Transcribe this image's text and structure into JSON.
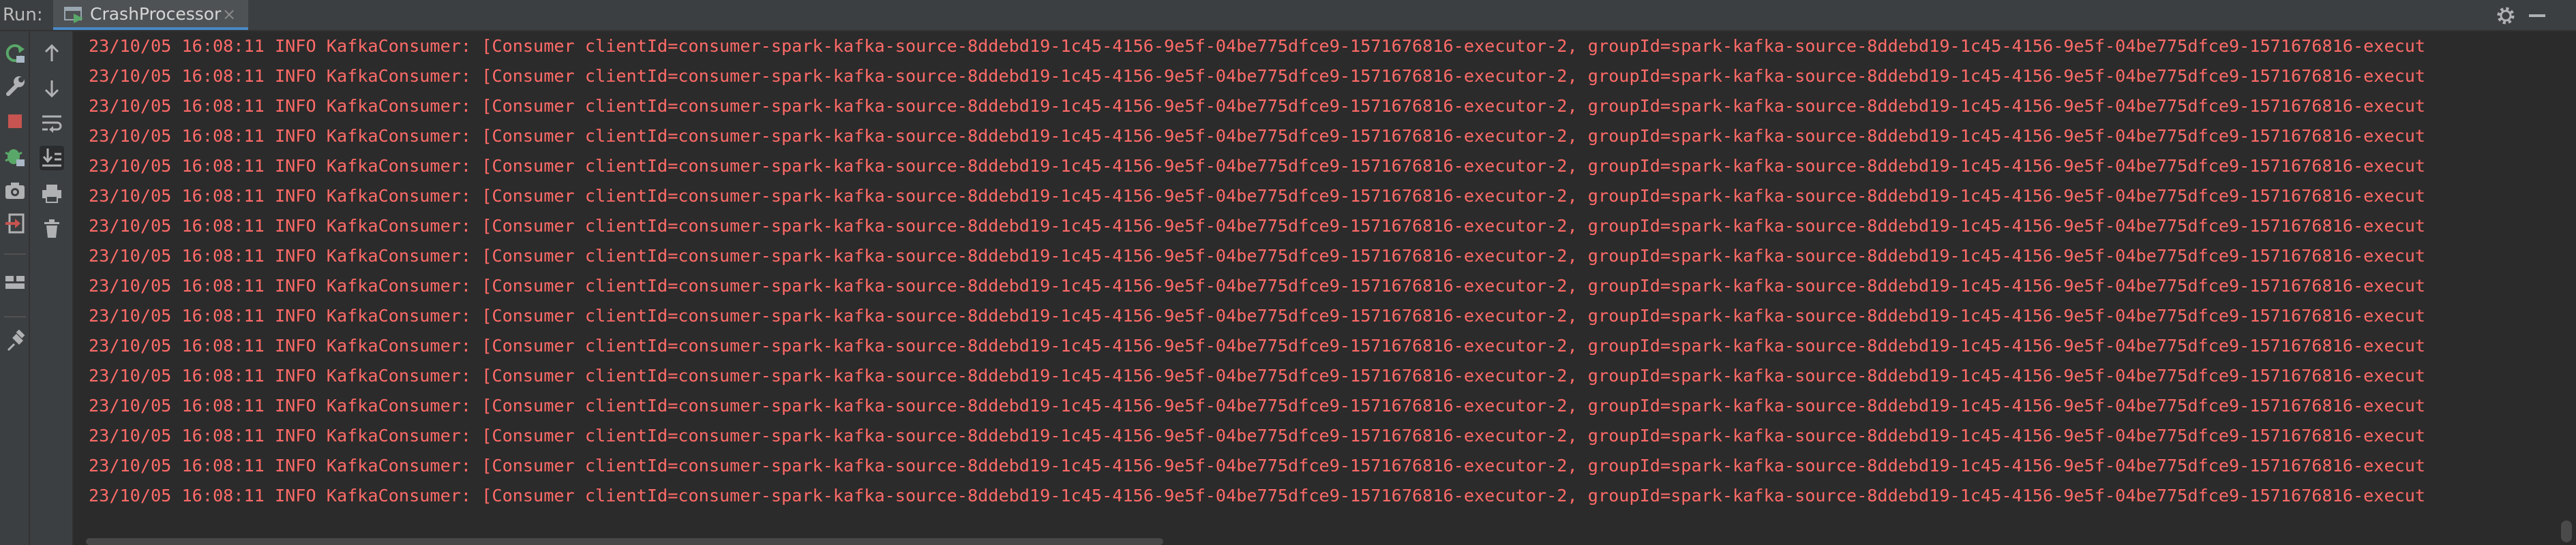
{
  "header": {
    "run_label": "Run:",
    "tab_label": "CrashProcessor",
    "tab_close": "×"
  },
  "icons": {
    "left_toolbar": [
      "rerun-icon",
      "wrench-icon",
      "stop-icon",
      "debug-icon",
      "camera-icon",
      "exit-icon",
      "layout-icon",
      "pin-icon"
    ],
    "right_toolbar": [
      "arrow-up-icon",
      "arrow-down-icon",
      "soft-wrap-icon",
      "scroll-to-end-icon",
      "print-icon",
      "trash-icon"
    ],
    "header_right": [
      "gear-icon",
      "minimize-icon"
    ]
  },
  "colors": {
    "log_text": "#ff6b68",
    "panel_bg": "#3c3f41",
    "console_bg": "#2b2b2b",
    "tab_accent": "#4a88c7"
  },
  "console": {
    "lines": [
      "23/10/05 16:08:11 INFO KafkaConsumer: [Consumer clientId=consumer-spark-kafka-source-8ddebd19-1c45-4156-9e5f-04be775dfce9-1571676816-executor-2, groupId=spark-kafka-source-8ddebd19-1c45-4156-9e5f-04be775dfce9-1571676816-execut",
      "23/10/05 16:08:11 INFO KafkaConsumer: [Consumer clientId=consumer-spark-kafka-source-8ddebd19-1c45-4156-9e5f-04be775dfce9-1571676816-executor-2, groupId=spark-kafka-source-8ddebd19-1c45-4156-9e5f-04be775dfce9-1571676816-execut",
      "23/10/05 16:08:11 INFO KafkaConsumer: [Consumer clientId=consumer-spark-kafka-source-8ddebd19-1c45-4156-9e5f-04be775dfce9-1571676816-executor-2, groupId=spark-kafka-source-8ddebd19-1c45-4156-9e5f-04be775dfce9-1571676816-execut",
      "23/10/05 16:08:11 INFO KafkaConsumer: [Consumer clientId=consumer-spark-kafka-source-8ddebd19-1c45-4156-9e5f-04be775dfce9-1571676816-executor-2, groupId=spark-kafka-source-8ddebd19-1c45-4156-9e5f-04be775dfce9-1571676816-execut",
      "23/10/05 16:08:11 INFO KafkaConsumer: [Consumer clientId=consumer-spark-kafka-source-8ddebd19-1c45-4156-9e5f-04be775dfce9-1571676816-executor-2, groupId=spark-kafka-source-8ddebd19-1c45-4156-9e5f-04be775dfce9-1571676816-execut",
      "23/10/05 16:08:11 INFO KafkaConsumer: [Consumer clientId=consumer-spark-kafka-source-8ddebd19-1c45-4156-9e5f-04be775dfce9-1571676816-executor-2, groupId=spark-kafka-source-8ddebd19-1c45-4156-9e5f-04be775dfce9-1571676816-execut",
      "23/10/05 16:08:11 INFO KafkaConsumer: [Consumer clientId=consumer-spark-kafka-source-8ddebd19-1c45-4156-9e5f-04be775dfce9-1571676816-executor-2, groupId=spark-kafka-source-8ddebd19-1c45-4156-9e5f-04be775dfce9-1571676816-execut",
      "23/10/05 16:08:11 INFO KafkaConsumer: [Consumer clientId=consumer-spark-kafka-source-8ddebd19-1c45-4156-9e5f-04be775dfce9-1571676816-executor-2, groupId=spark-kafka-source-8ddebd19-1c45-4156-9e5f-04be775dfce9-1571676816-execut",
      "23/10/05 16:08:11 INFO KafkaConsumer: [Consumer clientId=consumer-spark-kafka-source-8ddebd19-1c45-4156-9e5f-04be775dfce9-1571676816-executor-2, groupId=spark-kafka-source-8ddebd19-1c45-4156-9e5f-04be775dfce9-1571676816-execut",
      "23/10/05 16:08:11 INFO KafkaConsumer: [Consumer clientId=consumer-spark-kafka-source-8ddebd19-1c45-4156-9e5f-04be775dfce9-1571676816-executor-2, groupId=spark-kafka-source-8ddebd19-1c45-4156-9e5f-04be775dfce9-1571676816-execut",
      "23/10/05 16:08:11 INFO KafkaConsumer: [Consumer clientId=consumer-spark-kafka-source-8ddebd19-1c45-4156-9e5f-04be775dfce9-1571676816-executor-2, groupId=spark-kafka-source-8ddebd19-1c45-4156-9e5f-04be775dfce9-1571676816-execut",
      "23/10/05 16:08:11 INFO KafkaConsumer: [Consumer clientId=consumer-spark-kafka-source-8ddebd19-1c45-4156-9e5f-04be775dfce9-1571676816-executor-2, groupId=spark-kafka-source-8ddebd19-1c45-4156-9e5f-04be775dfce9-1571676816-execut",
      "23/10/05 16:08:11 INFO KafkaConsumer: [Consumer clientId=consumer-spark-kafka-source-8ddebd19-1c45-4156-9e5f-04be775dfce9-1571676816-executor-2, groupId=spark-kafka-source-8ddebd19-1c45-4156-9e5f-04be775dfce9-1571676816-execut",
      "23/10/05 16:08:11 INFO KafkaConsumer: [Consumer clientId=consumer-spark-kafka-source-8ddebd19-1c45-4156-9e5f-04be775dfce9-1571676816-executor-2, groupId=spark-kafka-source-8ddebd19-1c45-4156-9e5f-04be775dfce9-1571676816-execut",
      "23/10/05 16:08:11 INFO KafkaConsumer: [Consumer clientId=consumer-spark-kafka-source-8ddebd19-1c45-4156-9e5f-04be775dfce9-1571676816-executor-2, groupId=spark-kafka-source-8ddebd19-1c45-4156-9e5f-04be775dfce9-1571676816-execut",
      "23/10/05 16:08:11 INFO KafkaConsumer: [Consumer clientId=consumer-spark-kafka-source-8ddebd19-1c45-4156-9e5f-04be775dfce9-1571676816-executor-2, groupId=spark-kafka-source-8ddebd19-1c45-4156-9e5f-04be775dfce9-1571676816-execut"
    ]
  }
}
